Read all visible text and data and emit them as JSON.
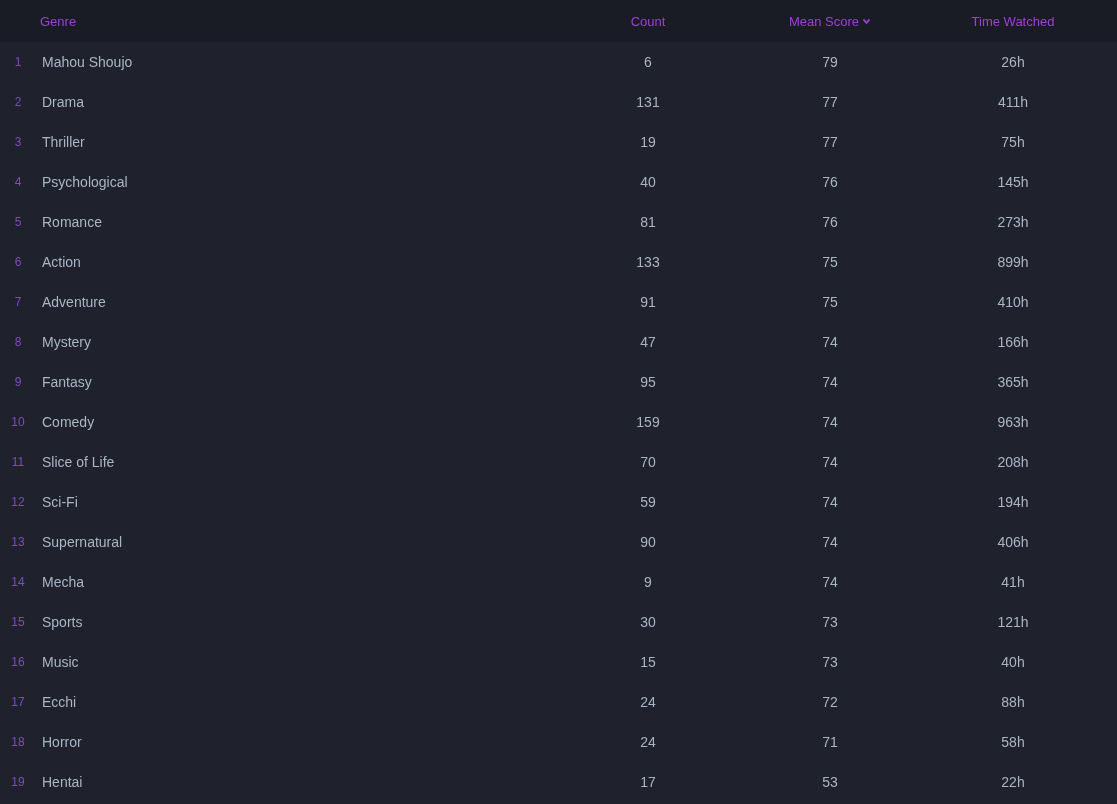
{
  "table": {
    "columns": [
      {
        "label": "Genre",
        "sorted": false
      },
      {
        "label": "Count",
        "sorted": false
      },
      {
        "label": "Mean Score",
        "sorted": true
      },
      {
        "label": "Time Watched",
        "sorted": false
      }
    ],
    "rows": [
      {
        "rank": "1",
        "genre": "Mahou Shoujo",
        "count": "6",
        "mean_score": "79",
        "time_watched": "26h"
      },
      {
        "rank": "2",
        "genre": "Drama",
        "count": "131",
        "mean_score": "77",
        "time_watched": "411h"
      },
      {
        "rank": "3",
        "genre": "Thriller",
        "count": "19",
        "mean_score": "77",
        "time_watched": "75h"
      },
      {
        "rank": "4",
        "genre": "Psychological",
        "count": "40",
        "mean_score": "76",
        "time_watched": "145h"
      },
      {
        "rank": "5",
        "genre": "Romance",
        "count": "81",
        "mean_score": "76",
        "time_watched": "273h"
      },
      {
        "rank": "6",
        "genre": "Action",
        "count": "133",
        "mean_score": "75",
        "time_watched": "899h"
      },
      {
        "rank": "7",
        "genre": "Adventure",
        "count": "91",
        "mean_score": "75",
        "time_watched": "410h"
      },
      {
        "rank": "8",
        "genre": "Mystery",
        "count": "47",
        "mean_score": "74",
        "time_watched": "166h"
      },
      {
        "rank": "9",
        "genre": "Fantasy",
        "count": "95",
        "mean_score": "74",
        "time_watched": "365h"
      },
      {
        "rank": "10",
        "genre": "Comedy",
        "count": "159",
        "mean_score": "74",
        "time_watched": "963h"
      },
      {
        "rank": "11",
        "genre": "Slice of Life",
        "count": "70",
        "mean_score": "74",
        "time_watched": "208h"
      },
      {
        "rank": "12",
        "genre": "Sci-Fi",
        "count": "59",
        "mean_score": "74",
        "time_watched": "194h"
      },
      {
        "rank": "13",
        "genre": "Supernatural",
        "count": "90",
        "mean_score": "74",
        "time_watched": "406h"
      },
      {
        "rank": "14",
        "genre": "Mecha",
        "count": "9",
        "mean_score": "74",
        "time_watched": "41h"
      },
      {
        "rank": "15",
        "genre": "Sports",
        "count": "30",
        "mean_score": "73",
        "time_watched": "121h"
      },
      {
        "rank": "16",
        "genre": "Music",
        "count": "15",
        "mean_score": "73",
        "time_watched": "40h"
      },
      {
        "rank": "17",
        "genre": "Ecchi",
        "count": "24",
        "mean_score": "72",
        "time_watched": "88h"
      },
      {
        "rank": "18",
        "genre": "Horror",
        "count": "24",
        "mean_score": "71",
        "time_watched": "58h"
      },
      {
        "rank": "19",
        "genre": "Hentai",
        "count": "17",
        "mean_score": "53",
        "time_watched": "22h"
      }
    ]
  }
}
